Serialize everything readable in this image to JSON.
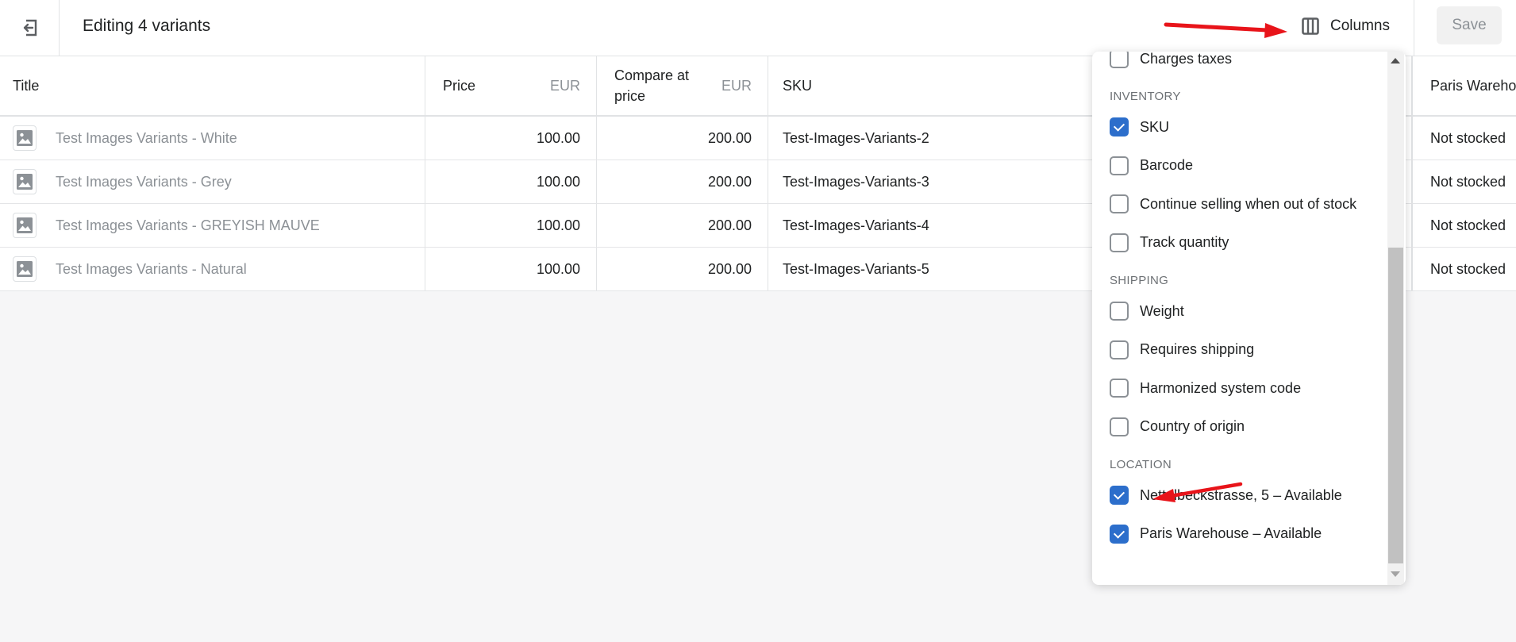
{
  "header": {
    "title": "Editing 4 variants",
    "columns_label": "Columns",
    "save_label": "Save"
  },
  "table": {
    "columns": {
      "title": "Title",
      "price": "Price",
      "price_currency": "EUR",
      "compare_at_price": "Compare at price",
      "compare_line1": "Compare at",
      "compare_line2": "price",
      "compare_currency": "EUR",
      "sku": "SKU",
      "paris_warehouse": "Paris Wareho"
    },
    "rows": [
      {
        "title": "Test Images Variants - White",
        "price": "100.00",
        "compare_at_price": "200.00",
        "sku": "Test-Images-Variants-2",
        "paris_warehouse": "Not stocked"
      },
      {
        "title": "Test Images Variants - Grey",
        "price": "100.00",
        "compare_at_price": "200.00",
        "sku": "Test-Images-Variants-3",
        "paris_warehouse": "Not stocked"
      },
      {
        "title": "Test Images Variants - GREYISH MAUVE",
        "price": "100.00",
        "compare_at_price": "200.00",
        "sku": "Test-Images-Variants-4",
        "paris_warehouse": "Not stocked"
      },
      {
        "title": "Test Images Variants - Natural",
        "price": "100.00",
        "compare_at_price": "200.00",
        "sku": "Test-Images-Variants-5",
        "paris_warehouse": "Not stocked"
      }
    ]
  },
  "columns_menu": {
    "items_top": [
      {
        "label": "Charges taxes",
        "checked": false
      }
    ],
    "sections": [
      {
        "title": "INVENTORY",
        "items": [
          {
            "label": "SKU",
            "checked": true
          },
          {
            "label": "Barcode",
            "checked": false
          },
          {
            "label": "Continue selling when out of stock",
            "checked": false
          },
          {
            "label": "Track quantity",
            "checked": false
          }
        ]
      },
      {
        "title": "SHIPPING",
        "items": [
          {
            "label": "Weight",
            "checked": false
          },
          {
            "label": "Requires shipping",
            "checked": false
          },
          {
            "label": "Harmonized system code",
            "checked": false
          },
          {
            "label": "Country of origin",
            "checked": false
          }
        ]
      },
      {
        "title": "LOCATION",
        "items": [
          {
            "label": "Nettelbeckstrasse, 5 – Available",
            "checked": true
          },
          {
            "label": "Paris Warehouse – Available",
            "checked": true
          }
        ]
      }
    ]
  },
  "colors": {
    "accent": "#2c6ecb",
    "annotation_arrow": "#e8141a"
  }
}
